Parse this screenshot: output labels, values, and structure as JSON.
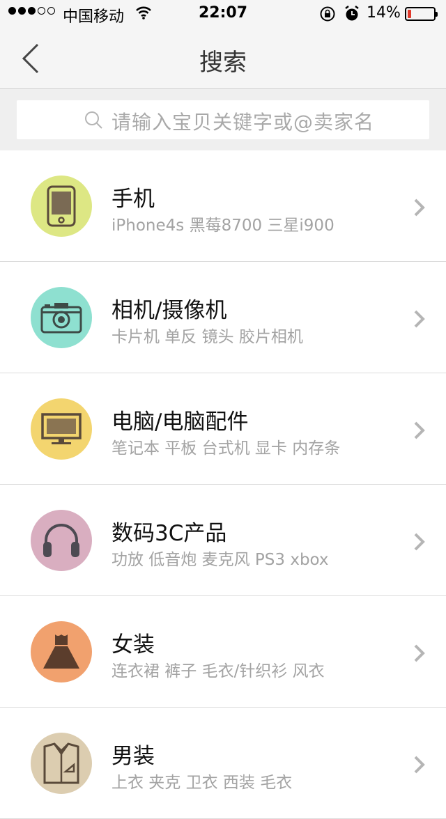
{
  "status_bar": {
    "carrier": "中国移动",
    "time": "22:07",
    "battery_percent": "14%",
    "signal_bars_filled": 3,
    "signal_bars_total": 5,
    "battery_level": 0.14,
    "battery_color": "#e03a2c"
  },
  "nav": {
    "title": "搜索",
    "back_icon": "chevron-left-icon"
  },
  "search": {
    "placeholder": "请输入宝贝关键字或@卖家名",
    "icon": "search-icon"
  },
  "categories": [
    {
      "title": "手机",
      "subtitle": "iPhone4s 黑莓8700 三星i900",
      "icon": "phone-icon",
      "color": "#dde784"
    },
    {
      "title": "相机/摄像机",
      "subtitle": "卡片机 单反 镜头 胶片相机",
      "icon": "camera-icon",
      "color": "#8ee0d0"
    },
    {
      "title": "电脑/电脑配件",
      "subtitle": "笔记本 平板 台式机 显卡 内存条",
      "icon": "monitor-icon",
      "color": "#f3d56f"
    },
    {
      "title": "数码3C产品",
      "subtitle": "功放 低音炮 麦克风 PS3 xbox",
      "icon": "headphones-icon",
      "color": "#d9aec0"
    },
    {
      "title": "女装",
      "subtitle": "连衣裙 裤子 毛衣/针织衫 风衣",
      "icon": "dress-icon",
      "color": "#f1a16e"
    },
    {
      "title": "男装",
      "subtitle": "上衣 夹克 卫衣 西装 毛衣",
      "icon": "shirt-icon",
      "color": "#dccdb0"
    }
  ],
  "colors": {
    "icon_stroke": "#5a4a3a",
    "chevron": "#b5b5b5"
  }
}
